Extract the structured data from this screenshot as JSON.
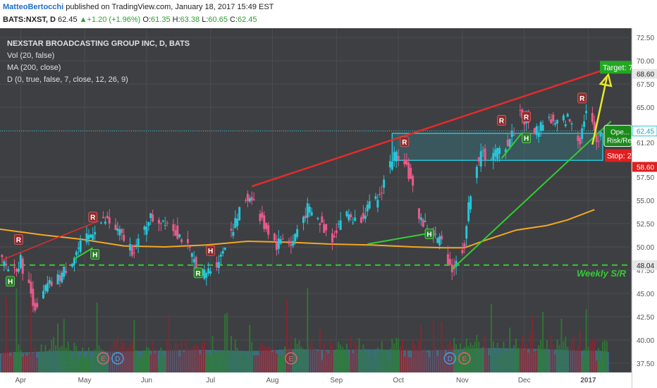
{
  "header": {
    "author": "MatteoBertocchi",
    "published": " published on TradingView.com, January 18, 2017 15:49 EST",
    "symbol": "BATS:NXST, D",
    "last": "62.45",
    "change": "+1.20 (+1.96%)",
    "o_label": "O:",
    "o_value": "61.35",
    "h_label": "H:",
    "h_value": "63.38",
    "l_label": "L:",
    "l_value": "60.65",
    "c_label": "C:",
    "c_value": "62.45"
  },
  "legend": {
    "title": "NEXSTAR BROADCASTING GROUP INC, D, BATS",
    "vol": "Vol (20, false)",
    "ma": "MA (200, close)",
    "d": "D (0, true, false, 7, close, 12, 26, 9)"
  },
  "colors": {
    "background": "#3d3f42",
    "grid": "#4b4d51",
    "up": "#26c6da",
    "down": "#e95a8a",
    "ma": "#f5a623",
    "red_line": "#e52b2b",
    "green_line": "#33cc33",
    "target": "#22a822",
    "stop": "#e01f1f",
    "box": "#26c6da",
    "arrow": "#e8e82a",
    "marker": "#8e2c30",
    "marker_h": "#2c7a2c"
  },
  "chart_data": {
    "type": "candlestick",
    "y_ticks": [
      "72.50",
      "70.00",
      "67.50",
      "65.00",
      "62.50",
      "61.20",
      "57.50",
      "55.00",
      "52.50",
      "50.00",
      "47.50",
      "45.00",
      "42.50",
      "40.00",
      "37.50"
    ],
    "y_tick_values": [
      72.5,
      70,
      67.5,
      65,
      62.5,
      61.2,
      57.5,
      55,
      52.5,
      50,
      47.5,
      45,
      42.5,
      40,
      37.5
    ],
    "ylim": [
      36.5,
      73.5
    ],
    "x_ticks": [
      "Apr",
      "May",
      "Jun",
      "Jul",
      "Aug",
      "Sep",
      "Oct",
      "Nov",
      "Dec",
      "2017"
    ],
    "x_tick_days": [
      10,
      41,
      71,
      102,
      132,
      163,
      193,
      224,
      254,
      285
    ],
    "xlim": [
      0,
      306
    ],
    "price_labels": [
      {
        "text": "68.60",
        "value": 68.6,
        "style": "light"
      },
      {
        "text": "62.45",
        "value": 62.45,
        "style": "cyan"
      },
      {
        "text": "58.60",
        "value": 58.6,
        "style": "red"
      },
      {
        "text": "48.04",
        "value": 48.04,
        "style": "light"
      }
    ],
    "current_price": 62.45,
    "weekly_sr": {
      "value": 48.04,
      "label": "Weekly S/R"
    },
    "target": {
      "text": "Target: 7...",
      "value": 69.3
    },
    "stop": {
      "text": "Stop: 2...",
      "value": 58.6
    },
    "position": {
      "line1": "Ope...",
      "line2": "Risk/Re..."
    },
    "box": {
      "x0": 190,
      "x1": 292,
      "y_top": 62.2,
      "y_bottom": 59.3
    },
    "red_trend": {
      "x0": 122,
      "y0": 56.5,
      "x1": 299,
      "y1": 69.5
    },
    "red_small": [
      {
        "x0": 1,
        "y0": 48.6,
        "x1": 48,
        "y1": 52.8
      }
    ],
    "green_lines": [
      {
        "x0": 219,
        "y0": 47.6,
        "x1": 296,
        "y1": 63.5
      },
      {
        "x0": 178,
        "y0": 50.3,
        "x1": 209,
        "y1": 51.5
      },
      {
        "x0": 36,
        "y0": 48.7,
        "x1": 45,
        "y1": 49.9
      },
      {
        "x0": 243,
        "y0": 59.5,
        "x1": 253,
        "y1": 62.3
      }
    ],
    "projection": {
      "x0": 287,
      "y0": 61.0,
      "x1": 294,
      "y1": 68.2
    },
    "markers": [
      {
        "text": "R",
        "day": 9,
        "value": 50.8,
        "kind": "R"
      },
      {
        "text": "H",
        "day": 5,
        "value": 46.3,
        "kind": "H"
      },
      {
        "text": "R",
        "day": 45,
        "value": 53.2,
        "kind": "R"
      },
      {
        "text": "H",
        "day": 46,
        "value": 49.2,
        "kind": "H"
      },
      {
        "text": "H",
        "day": 102,
        "value": 49.6,
        "kind": "R"
      },
      {
        "text": "R",
        "day": 96,
        "value": 47.2,
        "kind": "H"
      },
      {
        "text": "R",
        "day": 196,
        "value": 61.3,
        "kind": "R"
      },
      {
        "text": "H",
        "day": 208,
        "value": 51.4,
        "kind": "H"
      },
      {
        "text": "R",
        "day": 243,
        "value": 63.6,
        "kind": "R"
      },
      {
        "text": "R",
        "day": 255,
        "value": 64.0,
        "kind": "R"
      },
      {
        "text": "H",
        "day": 255,
        "value": 61.7,
        "kind": "H"
      },
      {
        "text": "R",
        "day": 282,
        "value": 66.0,
        "kind": "R"
      }
    ],
    "events": [
      {
        "text": "E",
        "day": 50,
        "kind": "E"
      },
      {
        "text": "D",
        "day": 57,
        "kind": "D"
      },
      {
        "text": "E",
        "day": 141,
        "kind": "E"
      },
      {
        "text": "D",
        "day": 218,
        "kind": "D"
      },
      {
        "text": "E",
        "day": 225,
        "kind": "E"
      }
    ],
    "ma_200": [
      [
        0,
        51.9
      ],
      [
        20,
        51.3
      ],
      [
        40,
        50.8
      ],
      [
        60,
        50.1
      ],
      [
        80,
        50.0
      ],
      [
        100,
        50.2
      ],
      [
        120,
        50.6
      ],
      [
        140,
        50.5
      ],
      [
        160,
        50.3
      ],
      [
        180,
        50.2
      ],
      [
        200,
        50.0
      ],
      [
        215,
        49.9
      ],
      [
        225,
        49.9
      ],
      [
        235,
        50.7
      ],
      [
        250,
        51.8
      ],
      [
        265,
        52.3
      ],
      [
        275,
        52.9
      ],
      [
        288,
        54.0
      ]
    ],
    "closes": [
      [
        0,
        48.5
      ],
      [
        6,
        47.4
      ],
      [
        10,
        48.5
      ],
      [
        15,
        45.0
      ],
      [
        18,
        43.0
      ],
      [
        22,
        45.5
      ],
      [
        28,
        46.5
      ],
      [
        33,
        48.0
      ],
      [
        38,
        49.8
      ],
      [
        43,
        51.0
      ],
      [
        47,
        52.5
      ],
      [
        52,
        52.8
      ],
      [
        57,
        51.6
      ],
      [
        61,
        50.6
      ],
      [
        64,
        49.7
      ],
      [
        68,
        50.5
      ],
      [
        72,
        53.2
      ],
      [
        76,
        52.8
      ],
      [
        80,
        53.0
      ],
      [
        84,
        52.0
      ],
      [
        88,
        51.0
      ],
      [
        91,
        49.8
      ],
      [
        95,
        48.0
      ],
      [
        99,
        47.0
      ],
      [
        103,
        47.8
      ],
      [
        107,
        49.0
      ],
      [
        110,
        51.2
      ],
      [
        114,
        52.5
      ],
      [
        118,
        55.0
      ],
      [
        122,
        55.5
      ],
      [
        126,
        53.0
      ],
      [
        130,
        51.8
      ],
      [
        134,
        50.2
      ],
      [
        138,
        51.5
      ],
      [
        141,
        50.0
      ],
      [
        145,
        52.5
      ],
      [
        149,
        54.0
      ],
      [
        153,
        53.2
      ],
      [
        157,
        52.0
      ],
      [
        161,
        51.0
      ],
      [
        165,
        53.0
      ],
      [
        169,
        53.5
      ],
      [
        173,
        52.5
      ],
      [
        177,
        54.0
      ],
      [
        181,
        54.5
      ],
      [
        184,
        55.5
      ],
      [
        187,
        58.0
      ],
      [
        190,
        59.5
      ],
      [
        193,
        60.0
      ],
      [
        196,
        59.5
      ],
      [
        199,
        57.0
      ],
      [
        202,
        54.0
      ],
      [
        205,
        52.5
      ],
      [
        208,
        52.0
      ],
      [
        211,
        51.0
      ],
      [
        214,
        50.5
      ],
      [
        217,
        48.8
      ],
      [
        219,
        47.6
      ],
      [
        222,
        48.5
      ],
      [
        225,
        50.5
      ],
      [
        228,
        56.0
      ],
      [
        231,
        59.0
      ],
      [
        234,
        60.0
      ],
      [
        237,
        59.5
      ],
      [
        240,
        60.0
      ],
      [
        243,
        60.5
      ],
      [
        246,
        61.2
      ],
      [
        249,
        62.5
      ],
      [
        251,
        65.0
      ],
      [
        254,
        63.5
      ],
      [
        257,
        63.0
      ],
      [
        260,
        62.5
      ],
      [
        263,
        63.5
      ],
      [
        266,
        63.8
      ],
      [
        269,
        63.0
      ],
      [
        272,
        63.5
      ],
      [
        275,
        63.8
      ],
      [
        278,
        63.0
      ],
      [
        281,
        61.5
      ],
      [
        283,
        64.0
      ],
      [
        285,
        65.0
      ],
      [
        287,
        63.0
      ],
      [
        289,
        61.4
      ],
      [
        291,
        62.45
      ]
    ],
    "volume": [
      [
        0,
        0.45
      ],
      [
        8,
        0.6
      ],
      [
        12,
        0.55
      ],
      [
        20,
        0.62
      ],
      [
        28,
        0.7
      ],
      [
        36,
        0.66
      ],
      [
        44,
        0.68
      ],
      [
        52,
        0.62
      ],
      [
        60,
        0.64
      ],
      [
        70,
        0.7
      ],
      [
        80,
        0.72
      ],
      [
        90,
        0.74
      ],
      [
        100,
        0.78
      ],
      [
        110,
        0.72
      ],
      [
        120,
        0.68
      ],
      [
        130,
        0.72
      ],
      [
        140,
        0.85
      ],
      [
        150,
        0.82
      ],
      [
        160,
        0.78
      ],
      [
        170,
        0.8
      ],
      [
        180,
        0.82
      ],
      [
        190,
        0.78
      ],
      [
        200,
        0.72
      ],
      [
        210,
        0.74
      ],
      [
        220,
        0.82
      ],
      [
        230,
        0.9
      ],
      [
        240,
        0.94
      ],
      [
        250,
        0.9
      ],
      [
        260,
        0.86
      ],
      [
        270,
        0.8
      ],
      [
        280,
        0.7
      ],
      [
        290,
        0.72
      ],
      [
        295,
        0.6
      ]
    ]
  }
}
